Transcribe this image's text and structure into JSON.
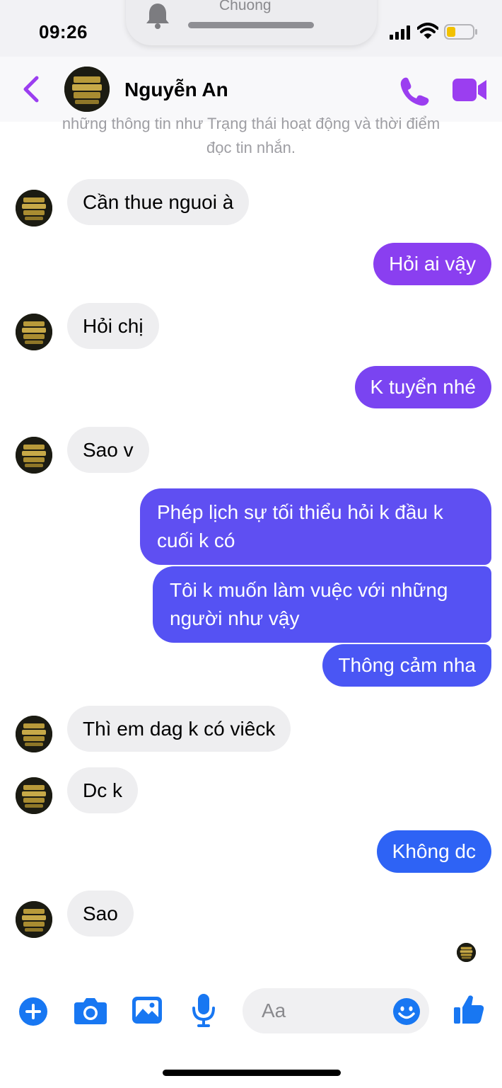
{
  "status_bar": {
    "time": "09:26",
    "notification_title": "Chuong"
  },
  "header": {
    "contact_name": "Nguyễn An",
    "back_icon": "chevron-left-icon",
    "call_icon": "phone-icon",
    "video_icon": "video-camera-icon",
    "accent_color": "#9b3ef0"
  },
  "encryption_note": {
    "line1": "những thông tin như Trạng thái hoạt động và thời điểm",
    "line2": "đọc tin nhắn."
  },
  "messages": [
    {
      "direction": "incoming",
      "text": "Cần thue nguoi à"
    },
    {
      "direction": "outgoing",
      "text": "Hỏi ai vậy",
      "color": "#8a3ff0"
    },
    {
      "direction": "incoming",
      "text": "Hỏi chị"
    },
    {
      "direction": "outgoing",
      "text": "K tuyển nhé",
      "color": "#7a44f1"
    },
    {
      "direction": "incoming",
      "text": "Sao v"
    },
    {
      "direction": "outgoing",
      "text": "Phép lịch sự tối thiểu hỏi k đầu k cuối k có",
      "color": "#5f4ff2"
    },
    {
      "direction": "outgoing",
      "text": "Tôi k muốn làm vuệc với những người như vậy",
      "color": "#5552f3"
    },
    {
      "direction": "outgoing",
      "text": "Thông cảm nha",
      "color": "#4a56f4"
    },
    {
      "direction": "incoming",
      "text": "Thì em dag k có viêck"
    },
    {
      "direction": "incoming",
      "text": "Dc k"
    },
    {
      "direction": "outgoing",
      "text": "Không dc",
      "color": "#2e63f5"
    },
    {
      "direction": "incoming",
      "text": "Sao"
    }
  ],
  "composer": {
    "placeholder": "Aa",
    "icons": [
      "plus-icon",
      "camera-icon",
      "photo-icon",
      "microphone-icon",
      "emoji-icon",
      "thumbs-up-icon"
    ],
    "icon_color": "#1877f2"
  }
}
